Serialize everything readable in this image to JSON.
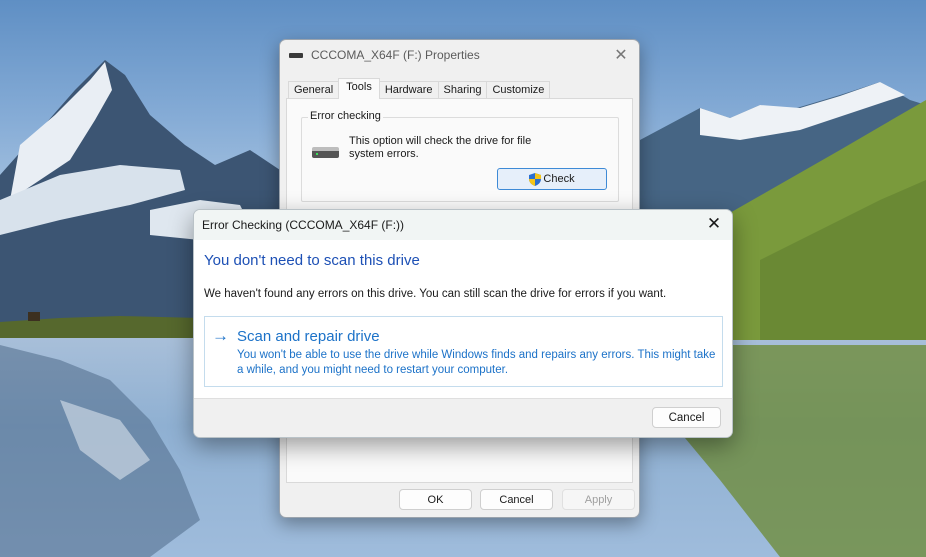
{
  "desktop": {
    "wallpaper": "mountain-lake"
  },
  "properties_window": {
    "title": "CCCOMA_X64F (F:) Properties",
    "icon": "drive-icon",
    "close_icon": "close-icon",
    "tabs": [
      {
        "label": "General",
        "active": false
      },
      {
        "label": "Tools",
        "active": true
      },
      {
        "label": "Hardware",
        "active": false
      },
      {
        "label": "Sharing",
        "active": false
      },
      {
        "label": "Customize",
        "active": false
      }
    ],
    "error_checking": {
      "group_label": "Error checking",
      "description": "This option will check the drive for file system errors.",
      "check_button": "Check",
      "check_button_icon": "uac-shield-icon"
    },
    "buttons": {
      "ok": "OK",
      "cancel": "Cancel",
      "apply": "Apply"
    }
  },
  "error_checking_dialog": {
    "title": "Error Checking (CCCOMA_X64F (F:))",
    "close_icon": "close-icon",
    "heading": "You don't need to scan this drive",
    "message": "We haven't found any errors on this drive. You can still scan the drive for errors if you want.",
    "option": {
      "arrow": "→",
      "title": "Scan and repair drive",
      "description": "You won't be able to use the drive while Windows finds and repairs any errors. This might take a while, and you might need to restart your computer."
    },
    "cancel_button": "Cancel",
    "colors": {
      "heading": "#1d50b5",
      "link": "#1c72c8"
    }
  }
}
